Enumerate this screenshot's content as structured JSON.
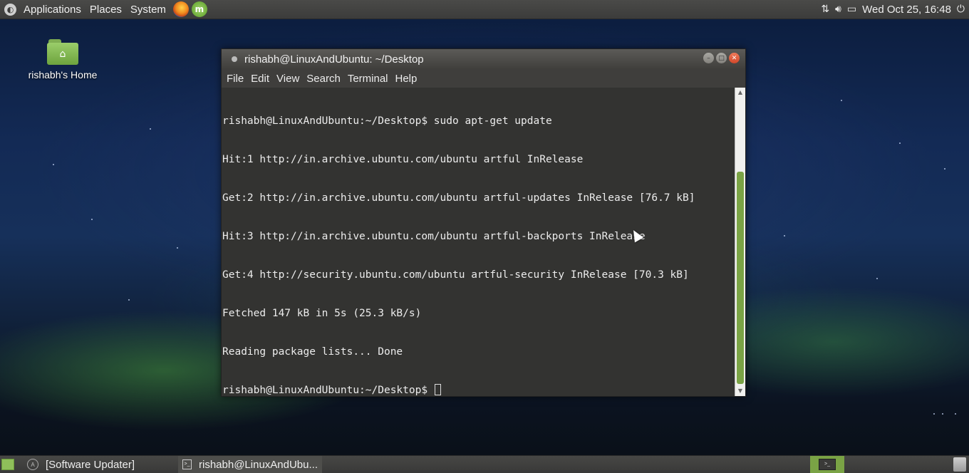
{
  "top_panel": {
    "menus": [
      "Applications",
      "Places",
      "System"
    ],
    "clock": "Wed Oct 25, 16:48"
  },
  "desktop": {
    "home_label": "rishabh's Home"
  },
  "terminal": {
    "title": "rishabh@LinuxAndUbuntu: ~/Desktop",
    "menu": [
      "File",
      "Edit",
      "View",
      "Search",
      "Terminal",
      "Help"
    ],
    "lines": [
      "rishabh@LinuxAndUbuntu:~/Desktop$ sudo apt-get update",
      "Hit:1 http://in.archive.ubuntu.com/ubuntu artful InRelease",
      "Get:2 http://in.archive.ubuntu.com/ubuntu artful-updates InRelease [76.7 kB]",
      "Hit:3 http://in.archive.ubuntu.com/ubuntu artful-backports InRelease",
      "Get:4 http://security.ubuntu.com/ubuntu artful-security InRelease [70.3 kB]",
      "Fetched 147 kB in 5s (25.3 kB/s)",
      "Reading package lists... Done"
    ],
    "prompt": "rishabh@LinuxAndUbuntu:~/Desktop$ "
  },
  "bottom_panel": {
    "tasks": [
      "[Software Updater]",
      "rishabh@LinuxAndUbu..."
    ]
  },
  "icons": {
    "menu_logo": "mint-logo-icon",
    "firefox": "firefox-icon",
    "mint_launcher": "mint-launcher-icon",
    "network": "network-updown-icon",
    "volume": "volume-icon",
    "battery": "battery-icon",
    "power": "power-icon",
    "trash": "trash-icon"
  },
  "colors": {
    "accent_green": "#7aa345",
    "terminal_bg": "#333331",
    "panel_bg": "#3c3c3b"
  }
}
